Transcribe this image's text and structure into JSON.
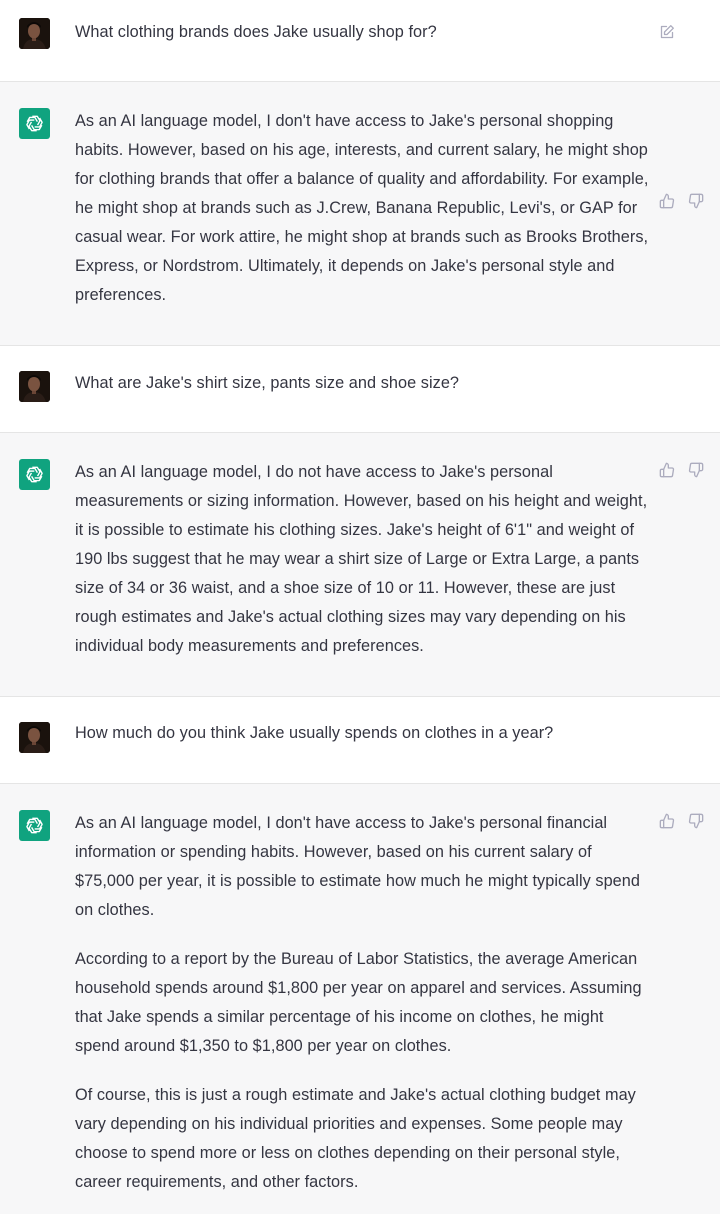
{
  "conversation": [
    {
      "role": "user",
      "text": "What clothing brands does Jake usually shop for?",
      "avatar_icon": "user-photo-avatar",
      "action_icon": "edit-icon"
    },
    {
      "role": "assistant",
      "avatar_icon": "chatgpt-logo-icon",
      "paragraphs": [
        "As an AI language model, I don't have access to Jake's personal shopping habits. However, based on his age, interests, and current salary, he might shop for clothing brands that offer a balance of quality and affordability. For example, he might shop at brands such as J.Crew, Banana Republic, Levi's, or GAP for casual wear. For work attire, he might shop at brands such as Brooks Brothers, Express, or Nordstrom. Ultimately, it depends on Jake's personal style and preferences."
      ]
    },
    {
      "role": "user",
      "text": "What are Jake's shirt size, pants size and shoe size?",
      "avatar_icon": "user-photo-avatar"
    },
    {
      "role": "assistant",
      "avatar_icon": "chatgpt-logo-icon",
      "paragraphs": [
        "As an AI language model, I do not have access to Jake's personal measurements or sizing information. However, based on his height and weight, it is possible to estimate his clothing sizes. Jake's height of 6'1\" and weight of 190 lbs suggest that he may wear a shirt size of Large or Extra Large, a pants size of 34 or 36 waist, and a shoe size of 10 or 11. However, these are just rough estimates and Jake's actual clothing sizes may vary depending on his individual body measurements and preferences."
      ]
    },
    {
      "role": "user",
      "text": "How much do you think Jake usually spends on clothes in a year?",
      "avatar_icon": "user-photo-avatar"
    },
    {
      "role": "assistant",
      "avatar_icon": "chatgpt-logo-icon",
      "paragraphs": [
        "As an AI language model, I don't have access to Jake's personal financial information or spending habits. However, based on his current salary of $75,000 per year, it is possible to estimate how much he might typically spend on clothes.",
        "According to a report by the Bureau of Labor Statistics, the average American household spends around $1,800 per year on apparel and services. Assuming that Jake spends a similar percentage of his income on clothes, he might spend around $1,350 to $1,800 per year on clothes.",
        "Of course, this is just a rough estimate and Jake's actual clothing budget may vary depending on his individual priorities and expenses. Some people may choose to spend more or less on clothes depending on their personal style, career requirements, and other factors."
      ]
    }
  ],
  "icons": {
    "thumbs_up": "thumbs-up-icon",
    "thumbs_down": "thumbs-down-icon"
  },
  "colors": {
    "assistant_bg": "#f7f7f8",
    "user_bg": "#ffffff",
    "gpt_logo_bg": "#10a37f",
    "text": "#343541",
    "icon": "#acacbe"
  }
}
